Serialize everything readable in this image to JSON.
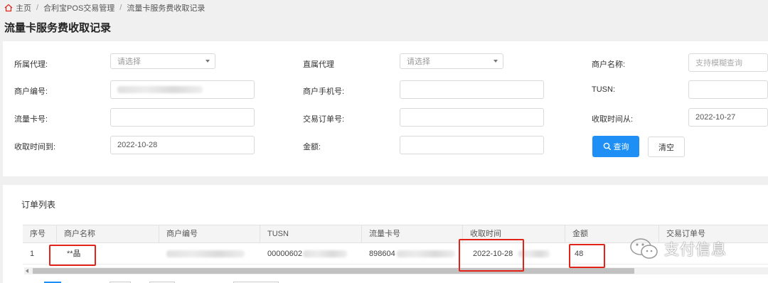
{
  "breadcrumb": {
    "home": "主页",
    "section": "合利宝POS交易管理",
    "current": "流量卡服务费收取记录"
  },
  "page_title": "流量卡服务费收取记录",
  "filters": {
    "agent_label": "所属代理:",
    "agent_placeholder": "请选择",
    "direct_agent_label": "直属代理",
    "direct_agent_placeholder": "请选择",
    "merchant_name_label": "商户名称:",
    "merchant_name_placeholder": "支持模糊查询",
    "merchant_no_label": "商户编号:",
    "merchant_phone_label": "商户手机号:",
    "tusn_label": "TUSN:",
    "card_no_label": "流量卡号:",
    "order_no_label": "交易订单号:",
    "time_from_label": "收取时间从:",
    "time_from_value": "2022-10-27",
    "time_to_label": "收取时间到:",
    "time_to_value": "2022-10-28",
    "amount_label": "金额:",
    "search_button": "查询",
    "clear_button": "清空"
  },
  "list": {
    "title": "订单列表",
    "columns": [
      "序号",
      "商户名称",
      "商户编号",
      "TUSN",
      "流量卡号",
      "收取时间",
      "金额",
      "交易订单号"
    ],
    "rows": [
      {
        "index": "1",
        "merchant_name": "**晶",
        "tusn_prefix": "00000602",
        "card_prefix": "898604",
        "time": "2022-10-28",
        "amount": "48"
      }
    ]
  },
  "watermark": {
    "text": "支付信息"
  },
  "colors": {
    "primary": "#1e90f5",
    "highlight": "#e2231a",
    "background": "#f0f0f0"
  }
}
